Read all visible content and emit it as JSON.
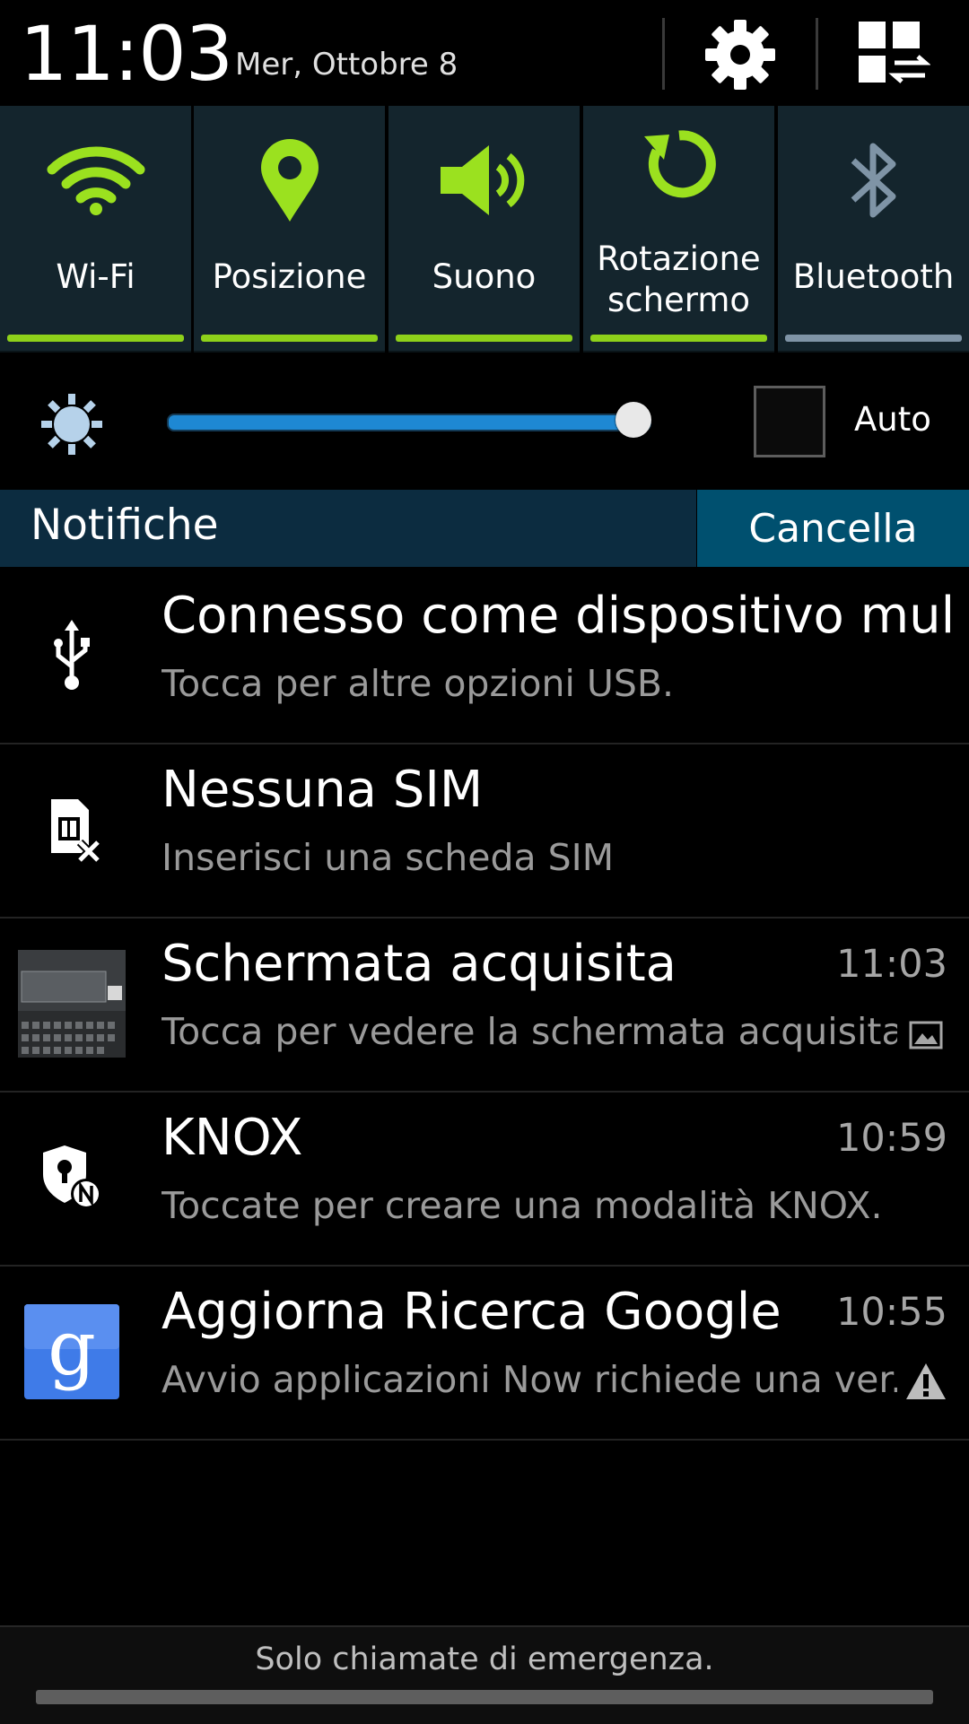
{
  "header": {
    "time": "11:03",
    "date": "Mer, Ottobre 8"
  },
  "quick_settings": [
    {
      "label": "Wi-Fi",
      "active": true
    },
    {
      "label": "Posizione",
      "active": true
    },
    {
      "label": "Suono",
      "active": true
    },
    {
      "label": "Rotazione\nschermo",
      "active": true
    },
    {
      "label": "Bluetooth",
      "active": false
    }
  ],
  "brightness": {
    "level": 0.97,
    "auto_label": "Auto",
    "auto_checked": false
  },
  "notifications_header": {
    "title": "Notifiche",
    "clear_label": "Cancella"
  },
  "notifications": [
    {
      "title": "Connesso come dispositivo mul..",
      "text": "Tocca per altre opzioni USB.",
      "time": "",
      "icon": "usb-icon"
    },
    {
      "title": "Nessuna SIM",
      "text": "Inserisci una scheda SIM",
      "time": "",
      "icon": "no-sim-icon"
    },
    {
      "title": "Schermata acquisita",
      "text": "Tocca per vedere la schermata acquisita",
      "time": "11:03",
      "icon": "screenshot-thumbnail"
    },
    {
      "title": "KNOX",
      "text": "Toccate per creare una modalità KNOX.",
      "time": "10:59",
      "icon": "knox-icon"
    },
    {
      "title": "Aggiorna Ricerca Google",
      "text": "Avvio applicazioni Now richiede una ver..",
      "time": "10:55",
      "icon": "google-search-icon"
    }
  ],
  "footer": {
    "text": "Solo chiamate di emergenza."
  },
  "colors": {
    "active_green": "#8ed11a",
    "inactive_gray": "#7f94a6",
    "tile_bg": "#14252d",
    "slider_blue": "#1e88d3",
    "clear_button": "#00506f"
  }
}
